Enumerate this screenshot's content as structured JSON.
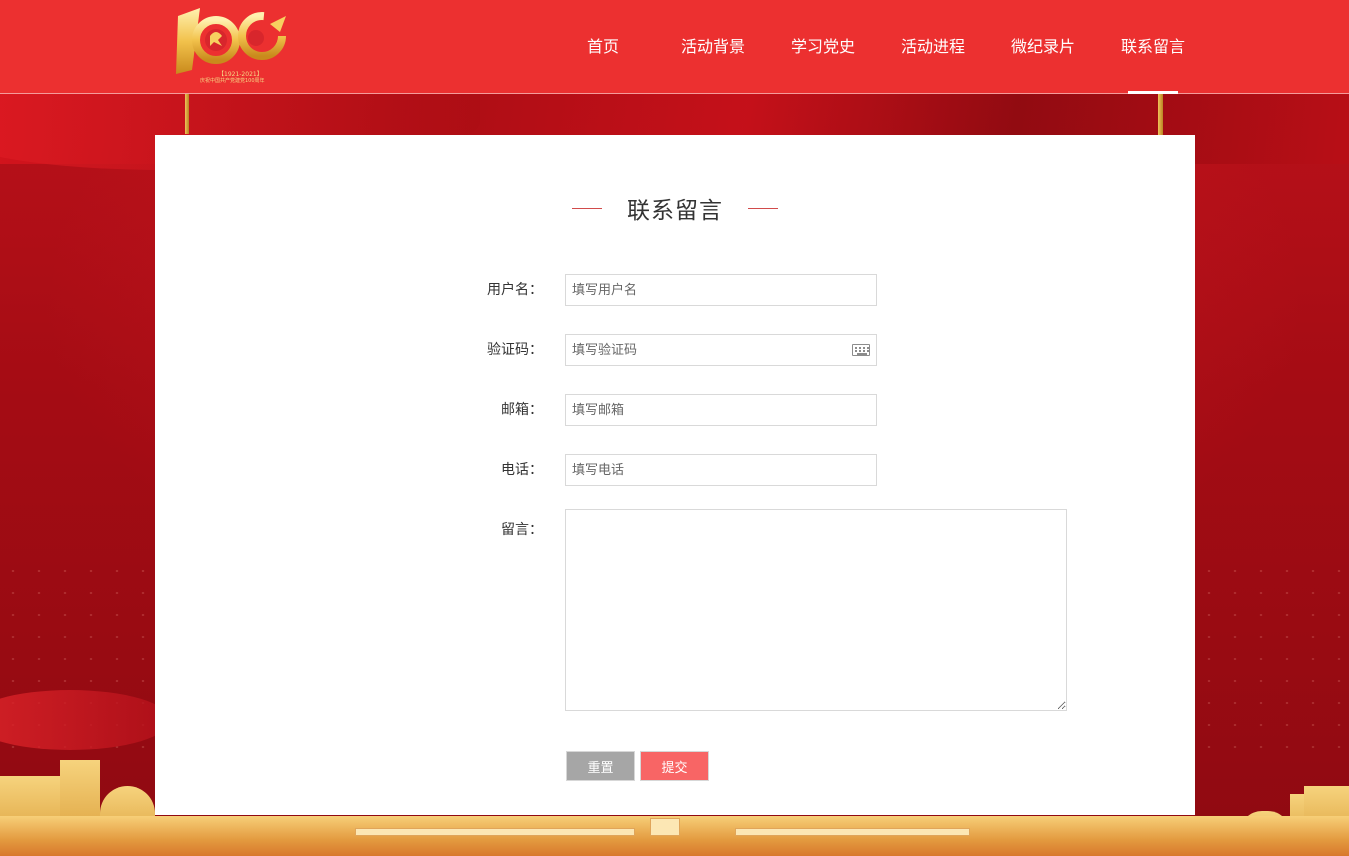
{
  "header": {
    "logo": {
      "number": "100",
      "caption_years": "【1921-2021】",
      "caption_text": "庆祝中国共产党建党100周年"
    },
    "nav": [
      {
        "label": "首页"
      },
      {
        "label": "活动背景"
      },
      {
        "label": "学习党史"
      },
      {
        "label": "活动进程"
      },
      {
        "label": "微纪录片"
      },
      {
        "label": "联系留言",
        "active": true
      }
    ]
  },
  "panel": {
    "title": "联系留言",
    "fields": {
      "username": {
        "label": "用户名：",
        "placeholder": "填写用户名",
        "value": ""
      },
      "captcha": {
        "label": "验证码：",
        "placeholder": "填写验证码",
        "value": ""
      },
      "email": {
        "label": "邮箱：",
        "placeholder": "填写邮箱",
        "value": ""
      },
      "phone": {
        "label": "电话：",
        "placeholder": "填写电话",
        "value": ""
      },
      "message": {
        "label": "留言：",
        "placeholder": "",
        "value": ""
      }
    },
    "buttons": {
      "reset": "重置",
      "submit": "提交"
    }
  },
  "colors": {
    "header_bg": "#ec3030",
    "submit_bg": "#f86565",
    "reset_bg": "#a6a6a6",
    "title_line": "#d14b4b"
  },
  "icons": {
    "captcha_field": "keyboard-icon",
    "logo_emblem": "party-emblem-icon"
  }
}
